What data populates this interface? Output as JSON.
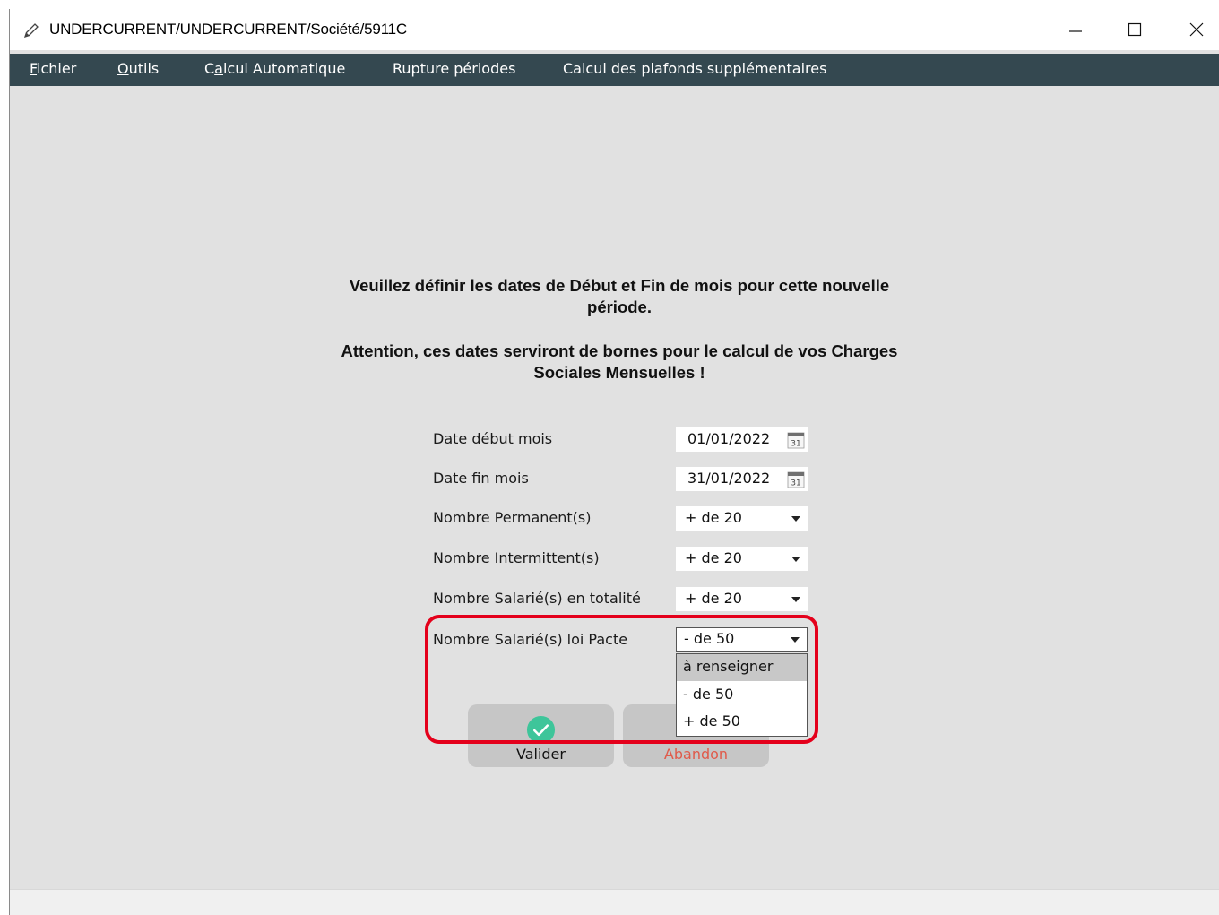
{
  "window": {
    "title": "UNDERCURRENT/UNDERCURRENT/Société/5911C",
    "controls": {
      "minimize": "minimize-icon",
      "maximize": "maximize-icon",
      "close": "close-icon"
    }
  },
  "menu": {
    "items": [
      {
        "mnemonic": "F",
        "rest": "ichier"
      },
      {
        "mnemonic": "O",
        "rest": "utils"
      },
      {
        "pre": "C",
        "mnemonic": "a",
        "rest": "lcul Automatique"
      },
      {
        "label": "Rupture périodes"
      },
      {
        "label": "Calcul des plafonds supplémentaires"
      }
    ]
  },
  "message": {
    "line1": "Veuillez définir les dates de Début et Fin de mois pour cette nouvelle",
    "line1b": "période.",
    "line2": "Attention, ces dates serviront  de bornes pour le calcul de vos Charges",
    "line2b": "Sociales Mensuelles !"
  },
  "form": {
    "date_debut": {
      "label": "Date début mois",
      "value": "01/01/2022"
    },
    "date_fin": {
      "label": "Date fin mois",
      "value": "31/01/2022"
    },
    "permanents": {
      "label": "Nombre Permanent(s)",
      "value": "+ de 20"
    },
    "intermittents": {
      "label": "Nombre Intermittent(s)",
      "value": "+ de 20"
    },
    "salaries_totalite": {
      "label": "Nombre Salarié(s) en totalité",
      "value": "+ de 20"
    },
    "salaries_pacte": {
      "label": "Nombre Salarié(s) loi Pacte",
      "value": "- de 50",
      "options": [
        "à renseigner",
        "- de 50",
        "+ de 50"
      ],
      "highlighted_option": "à renseigner"
    },
    "calendar_icon_text": "31"
  },
  "buttons": {
    "valider": "Valider",
    "abandon": "Abandon"
  },
  "colors": {
    "menubar": "#344850",
    "content_bg": "#e1e1e1",
    "accent_check": "#3ec59a",
    "abandon_text": "#e05a4a",
    "highlight_box": "#e4001b"
  }
}
